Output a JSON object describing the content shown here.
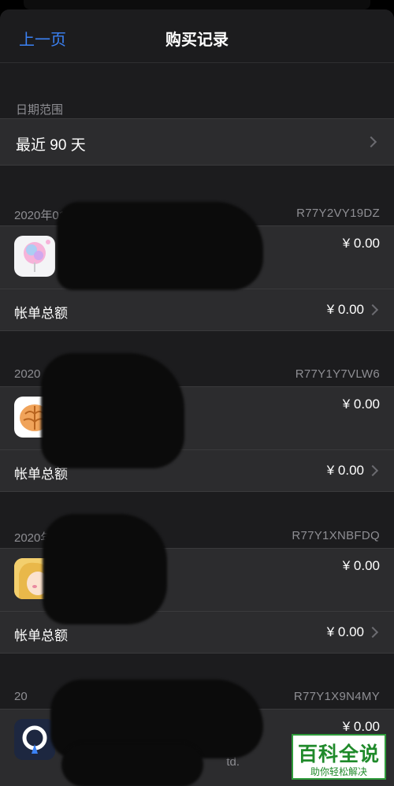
{
  "nav": {
    "back_label": "上一页",
    "title": "购买记录"
  },
  "date_range": {
    "section_label": "日期范围",
    "value": "最近 90 天"
  },
  "orders": [
    {
      "date": "2020年01月19日",
      "order_id": "R77Y2VY19DZ",
      "price": "¥ 0.00",
      "total_label": "帐单总额",
      "total": "¥ 0.00",
      "icon": "cotton-candy-app-icon"
    },
    {
      "date": "2020",
      "order_id": "R77Y1Y7VLW6",
      "price": "¥ 0.00",
      "total_label": "帐单总额",
      "total": "¥ 0.00",
      "icon": "brain-app-icon"
    },
    {
      "date": "2020年01月11日",
      "order_id": "R77Y1XNBFDQ",
      "price": "¥ 0.00",
      "total_label": "帐单总额",
      "total": "¥ 0.00",
      "icon": "cartoon-girl-app-icon"
    },
    {
      "date": "20",
      "order_id": "R77Y1X9N4MY",
      "price": "¥ 0.00",
      "sub": "td.",
      "icon": "drop-logo-app-icon"
    }
  ],
  "watermark": {
    "main": "百科全说",
    "sub": "助你轻松解决"
  },
  "colors": {
    "accent": "#3b82f6",
    "background": "#1c1c1e",
    "cell": "#2c2c2e",
    "secondary_text": "#8e8e93"
  }
}
